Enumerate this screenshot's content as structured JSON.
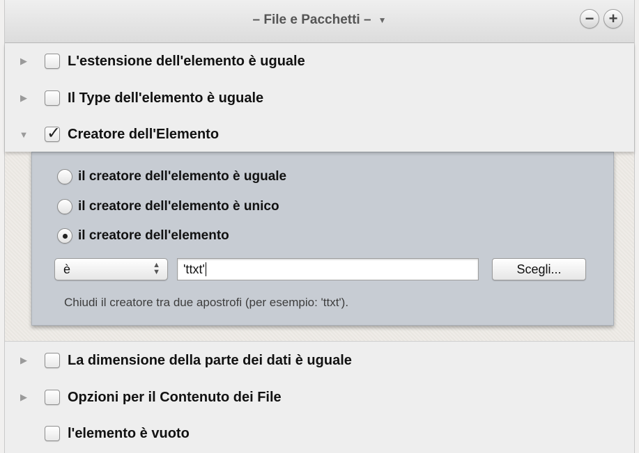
{
  "header": {
    "title": "– File e Pacchetti –",
    "dropdown_icon": "chevron-down-icon",
    "minus_symbol": "−",
    "plus_symbol": "+"
  },
  "criteria": [
    {
      "label": "L'estensione dell'elemento è uguale",
      "checked": false,
      "expanded": false
    },
    {
      "label": "Il Type dell'elemento è uguale",
      "checked": false,
      "expanded": false
    },
    {
      "label": "Creatore dell'Elemento",
      "checked": true,
      "expanded": true
    }
  ],
  "creator_panel": {
    "radios": [
      {
        "label": "il creatore dell'elemento è uguale",
        "selected": false
      },
      {
        "label": "il creatore dell'elemento è unico",
        "selected": false
      },
      {
        "label": "il creatore dell'elemento",
        "selected": true
      }
    ],
    "operator_value": "è",
    "creator_value": "'ttxt'",
    "choose_button": "Scegli...",
    "hint": "Chiudi il creatore tra due apostrofi (per esempio: 'ttxt')."
  },
  "criteria_bottom": [
    {
      "label": "La dimensione della parte dei dati è uguale",
      "checked": false,
      "expanded": false
    },
    {
      "label": "Opzioni per il Contenuto dei File",
      "checked": false,
      "expanded": false
    },
    {
      "label": "l'elemento è vuoto",
      "checked": false
    }
  ]
}
